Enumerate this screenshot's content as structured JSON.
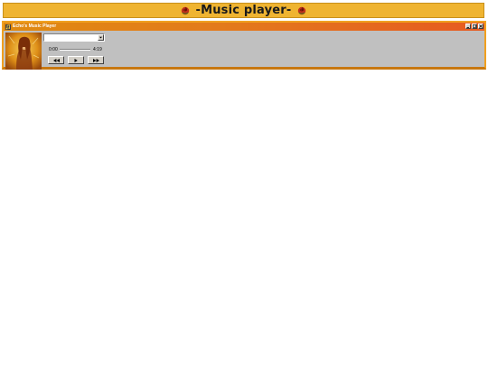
{
  "banner": {
    "title": "-Music player-",
    "left_icon": "rose-icon",
    "right_icon": "rose-icon"
  },
  "window": {
    "title": "Echo's Music Player",
    "app_icon": "music-note-icon",
    "buttons": [
      "minimize-icon",
      "maximize-icon",
      "close-icon"
    ]
  },
  "player": {
    "track_select_value": "",
    "current_time": "0:00",
    "total_time": "4:19",
    "progress": 0,
    "controls": [
      "rewind-icon",
      "play-icon",
      "fast-forward-icon"
    ]
  },
  "colors": {
    "banner": "#efb431",
    "window_frame": "#f0a020",
    "titlebar_end": "#e65a20",
    "client": "#c0c0c0"
  }
}
